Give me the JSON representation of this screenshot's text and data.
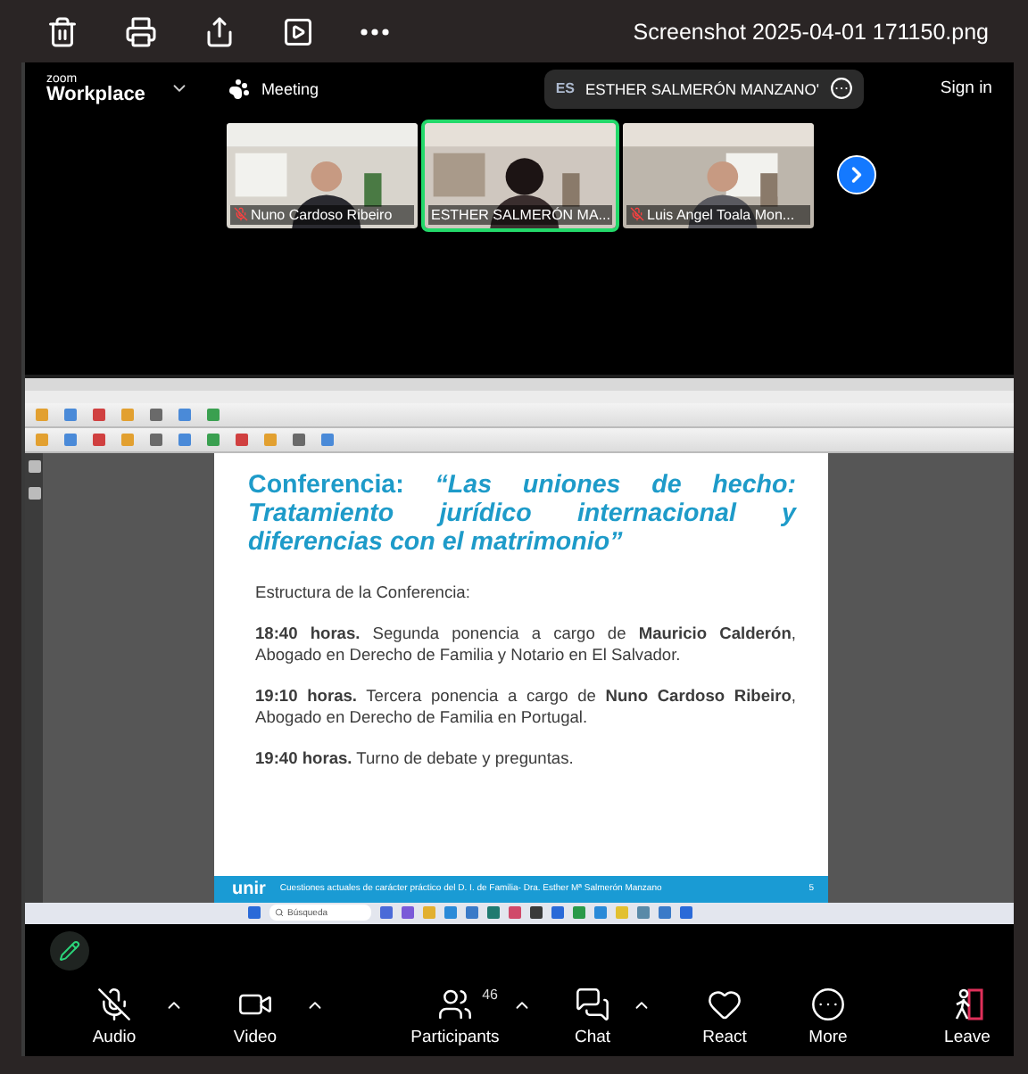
{
  "viewer": {
    "title": "Screenshot 2025-04-01 171150.png"
  },
  "header": {
    "brand_small": "zoom",
    "brand": "Workplace",
    "meeting_label": "Meeting",
    "speaker_initials": "ES",
    "speaker_name": "ESTHER SALMERÓN MANZANO'",
    "sign_in": "Sign in"
  },
  "participants": [
    {
      "name": "Nuno Cardoso Ribeiro",
      "muted": true,
      "active": false
    },
    {
      "name": "ESTHER SALMERÓN MA...",
      "muted": false,
      "active": true
    },
    {
      "name": "Luis Angel Toala Mon...",
      "muted": true,
      "active": false
    }
  ],
  "slide": {
    "title": "Conferencia: *“Las uniones de hecho: Tratamiento jurídico internacional y diferencias con el matrimonio”*",
    "paragraphs": [
      "Estructura de la Conferencia:",
      "**18:40 horas.** Segunda ponencia a cargo de **Mauricio Calderón**, Abogado en Derecho de Familia y Notario en El Salvador.",
      "**19:10 horas.** Tercera ponencia a cargo de **Nuno Cardoso Ribeiro**, Abogado en Derecho de Familia en Portugal.",
      "**19:40 horas.** Turno de debate y preguntas."
    ],
    "logo": "unir",
    "footer": "Cuestiones actuales de carácter práctico del D. I. de Familia- Dra. Esther Mª Salmerón Manzano",
    "page": "5"
  },
  "taskbar": {
    "search_placeholder": "Búsqueda"
  },
  "toolbar": [
    {
      "kind": "audio",
      "label": "Audio",
      "muted": true,
      "caret": true
    },
    {
      "kind": "video",
      "label": "Video",
      "caret": true
    },
    {
      "kind": "participants",
      "label": "Participants",
      "count": "46",
      "caret": true
    },
    {
      "kind": "chat",
      "label": "Chat",
      "caret": true
    },
    {
      "kind": "react",
      "label": "React",
      "caret": false
    },
    {
      "kind": "more",
      "label": "More",
      "caret": false
    },
    {
      "kind": "leave",
      "label": "Leave",
      "caret": false
    }
  ]
}
